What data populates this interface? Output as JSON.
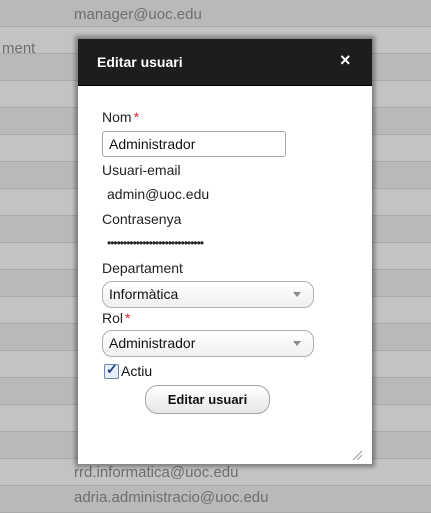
{
  "background": {
    "top_email": "manager@uoc.edu",
    "left_label": "ment",
    "bottom_email_1": "rrd.informatica@uoc.edu",
    "bottom_email_2": "adria.administracio@uoc.edu"
  },
  "dialog": {
    "title": "Editar usuari",
    "close_label": "×",
    "nom": {
      "label": "Nom",
      "required_mark": "*",
      "value": "Administrador"
    },
    "email": {
      "label": "Usuari-email",
      "value": "admin@uoc.edu"
    },
    "password": {
      "label": "Contrasenya",
      "value": "••••••••••••••••••••••••••••••"
    },
    "department": {
      "label": "Departament",
      "selected": "Informàtica"
    },
    "role": {
      "label": "Rol",
      "required_mark": "*",
      "selected": "Administrador"
    },
    "active": {
      "label": "Actiu",
      "checked": true,
      "check_glyph": "✓"
    },
    "submit_label": "Editar usuari"
  }
}
